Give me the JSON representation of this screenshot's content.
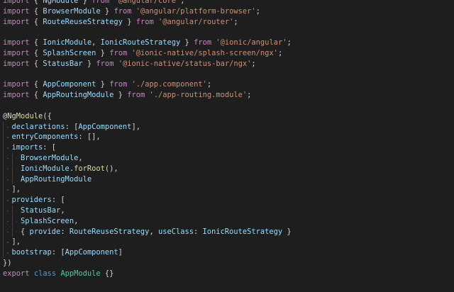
{
  "theme": {
    "background": "#1e1e1e",
    "colors": {
      "keyword": "#c586c0",
      "storage": "#569cd6",
      "string": "#ce9178",
      "identifier": "#9cdcfe",
      "type": "#4ec9b0",
      "function": "#dcdcaa",
      "punctuation": "#d4d4d4"
    }
  },
  "editor": {
    "lines": [
      {
        "indent": 0,
        "tokens": [
          {
            "t": "import",
            "c": "keyword"
          },
          {
            "t": " { ",
            "c": "punctuation"
          },
          {
            "t": "NgModule",
            "c": "identifier"
          },
          {
            "t": " } ",
            "c": "punctuation"
          },
          {
            "t": "from",
            "c": "keyword"
          },
          {
            "t": " ",
            "c": "punctuation"
          },
          {
            "t": "'@angular/core'",
            "c": "string"
          },
          {
            "t": ";",
            "c": "punctuation"
          }
        ]
      },
      {
        "indent": 0,
        "tokens": [
          {
            "t": "import",
            "c": "keyword"
          },
          {
            "t": " { ",
            "c": "punctuation"
          },
          {
            "t": "BrowserModule",
            "c": "identifier"
          },
          {
            "t": " } ",
            "c": "punctuation"
          },
          {
            "t": "from",
            "c": "keyword"
          },
          {
            "t": " ",
            "c": "punctuation"
          },
          {
            "t": "'@angular/platform-browser'",
            "c": "string"
          },
          {
            "t": ";",
            "c": "punctuation"
          }
        ]
      },
      {
        "indent": 0,
        "tokens": [
          {
            "t": "import",
            "c": "keyword"
          },
          {
            "t": " { ",
            "c": "punctuation"
          },
          {
            "t": "RouteReuseStrategy",
            "c": "identifier"
          },
          {
            "t": " } ",
            "c": "punctuation"
          },
          {
            "t": "from",
            "c": "keyword"
          },
          {
            "t": " ",
            "c": "punctuation"
          },
          {
            "t": "'@angular/router'",
            "c": "string"
          },
          {
            "t": ";",
            "c": "punctuation"
          }
        ]
      },
      {
        "indent": 0,
        "tokens": []
      },
      {
        "indent": 0,
        "tokens": [
          {
            "t": "import",
            "c": "keyword"
          },
          {
            "t": " { ",
            "c": "punctuation"
          },
          {
            "t": "IonicModule",
            "c": "identifier"
          },
          {
            "t": ", ",
            "c": "punctuation"
          },
          {
            "t": "IonicRouteStrategy",
            "c": "identifier"
          },
          {
            "t": " } ",
            "c": "punctuation"
          },
          {
            "t": "from",
            "c": "keyword"
          },
          {
            "t": " ",
            "c": "punctuation"
          },
          {
            "t": "'@ionic/angular'",
            "c": "string"
          },
          {
            "t": ";",
            "c": "punctuation"
          }
        ]
      },
      {
        "indent": 0,
        "tokens": [
          {
            "t": "import",
            "c": "keyword"
          },
          {
            "t": " { ",
            "c": "punctuation"
          },
          {
            "t": "SplashScreen",
            "c": "identifier"
          },
          {
            "t": " } ",
            "c": "punctuation"
          },
          {
            "t": "from",
            "c": "keyword"
          },
          {
            "t": " ",
            "c": "punctuation"
          },
          {
            "t": "'@ionic-native/splash-screen/ngx'",
            "c": "string"
          },
          {
            "t": ";",
            "c": "punctuation"
          }
        ]
      },
      {
        "indent": 0,
        "tokens": [
          {
            "t": "import",
            "c": "keyword"
          },
          {
            "t": " { ",
            "c": "punctuation"
          },
          {
            "t": "StatusBar",
            "c": "identifier"
          },
          {
            "t": " } ",
            "c": "punctuation"
          },
          {
            "t": "from",
            "c": "keyword"
          },
          {
            "t": " ",
            "c": "punctuation"
          },
          {
            "t": "'@ionic-native/status-bar/ngx'",
            "c": "string"
          },
          {
            "t": ";",
            "c": "punctuation"
          }
        ]
      },
      {
        "indent": 0,
        "tokens": []
      },
      {
        "indent": 0,
        "tokens": [
          {
            "t": "import",
            "c": "keyword"
          },
          {
            "t": " { ",
            "c": "punctuation"
          },
          {
            "t": "AppComponent",
            "c": "identifier"
          },
          {
            "t": " } ",
            "c": "punctuation"
          },
          {
            "t": "from",
            "c": "keyword"
          },
          {
            "t": " ",
            "c": "punctuation"
          },
          {
            "t": "'./app.component'",
            "c": "string"
          },
          {
            "t": ";",
            "c": "punctuation"
          }
        ]
      },
      {
        "indent": 0,
        "tokens": [
          {
            "t": "import",
            "c": "keyword"
          },
          {
            "t": " { ",
            "c": "punctuation"
          },
          {
            "t": "AppRoutingModule",
            "c": "identifier"
          },
          {
            "t": " } ",
            "c": "punctuation"
          },
          {
            "t": "from",
            "c": "keyword"
          },
          {
            "t": " ",
            "c": "punctuation"
          },
          {
            "t": "'./app-routing.module'",
            "c": "string"
          },
          {
            "t": ";",
            "c": "punctuation"
          }
        ]
      },
      {
        "indent": 0,
        "tokens": []
      },
      {
        "indent": 0,
        "tokens": [
          {
            "t": "@",
            "c": "punctuation"
          },
          {
            "t": "NgModule",
            "c": "function"
          },
          {
            "t": "({",
            "c": "punctuation"
          }
        ]
      },
      {
        "indent": 1,
        "tokens": [
          {
            "t": "declarations",
            "c": "identifier"
          },
          {
            "t": ": [",
            "c": "punctuation"
          },
          {
            "t": "AppComponent",
            "c": "identifier"
          },
          {
            "t": "],",
            "c": "punctuation"
          }
        ]
      },
      {
        "indent": 1,
        "tokens": [
          {
            "t": "entryComponents",
            "c": "identifier"
          },
          {
            "t": ": [],",
            "c": "punctuation"
          }
        ]
      },
      {
        "indent": 1,
        "tokens": [
          {
            "t": "imports",
            "c": "identifier"
          },
          {
            "t": ": [",
            "c": "punctuation"
          }
        ]
      },
      {
        "indent": 2,
        "tokens": [
          {
            "t": "BrowserModule",
            "c": "identifier"
          },
          {
            "t": ",",
            "c": "punctuation"
          }
        ]
      },
      {
        "indent": 2,
        "tokens": [
          {
            "t": "IonicModule",
            "c": "identifier"
          },
          {
            "t": ".",
            "c": "punctuation"
          },
          {
            "t": "forRoot",
            "c": "function"
          },
          {
            "t": "(),",
            "c": "punctuation"
          }
        ]
      },
      {
        "indent": 2,
        "tokens": [
          {
            "t": "AppRoutingModule",
            "c": "identifier"
          }
        ]
      },
      {
        "indent": 1,
        "tokens": [
          {
            "t": "],",
            "c": "punctuation"
          }
        ]
      },
      {
        "indent": 1,
        "tokens": [
          {
            "t": "providers",
            "c": "identifier"
          },
          {
            "t": ": [",
            "c": "punctuation"
          }
        ]
      },
      {
        "indent": 2,
        "tokens": [
          {
            "t": "StatusBar",
            "c": "identifier"
          },
          {
            "t": ",",
            "c": "punctuation"
          }
        ]
      },
      {
        "indent": 2,
        "tokens": [
          {
            "t": "SplashScreen",
            "c": "identifier"
          },
          {
            "t": ",",
            "c": "punctuation"
          }
        ]
      },
      {
        "indent": 2,
        "tokens": [
          {
            "t": "{ ",
            "c": "punctuation"
          },
          {
            "t": "provide",
            "c": "identifier"
          },
          {
            "t": ": ",
            "c": "punctuation"
          },
          {
            "t": "RouteReuseStrategy",
            "c": "identifier"
          },
          {
            "t": ", ",
            "c": "punctuation"
          },
          {
            "t": "useClass",
            "c": "identifier"
          },
          {
            "t": ": ",
            "c": "punctuation"
          },
          {
            "t": "IonicRouteStrategy",
            "c": "identifier"
          },
          {
            "t": " }",
            "c": "punctuation"
          }
        ]
      },
      {
        "indent": 1,
        "tokens": [
          {
            "t": "],",
            "c": "punctuation"
          }
        ]
      },
      {
        "indent": 1,
        "tokens": [
          {
            "t": "bootstrap",
            "c": "identifier"
          },
          {
            "t": ": [",
            "c": "punctuation"
          },
          {
            "t": "AppComponent",
            "c": "identifier"
          },
          {
            "t": "]",
            "c": "punctuation"
          }
        ]
      },
      {
        "indent": 0,
        "tokens": [
          {
            "t": "})",
            "c": "punctuation"
          }
        ]
      },
      {
        "indent": 0,
        "tokens": [
          {
            "t": "export",
            "c": "keyword"
          },
          {
            "t": " ",
            "c": "punctuation"
          },
          {
            "t": "class",
            "c": "storage"
          },
          {
            "t": " ",
            "c": "punctuation"
          },
          {
            "t": "AppModule",
            "c": "type"
          },
          {
            "t": " {}",
            "c": "punctuation"
          }
        ]
      }
    ]
  }
}
